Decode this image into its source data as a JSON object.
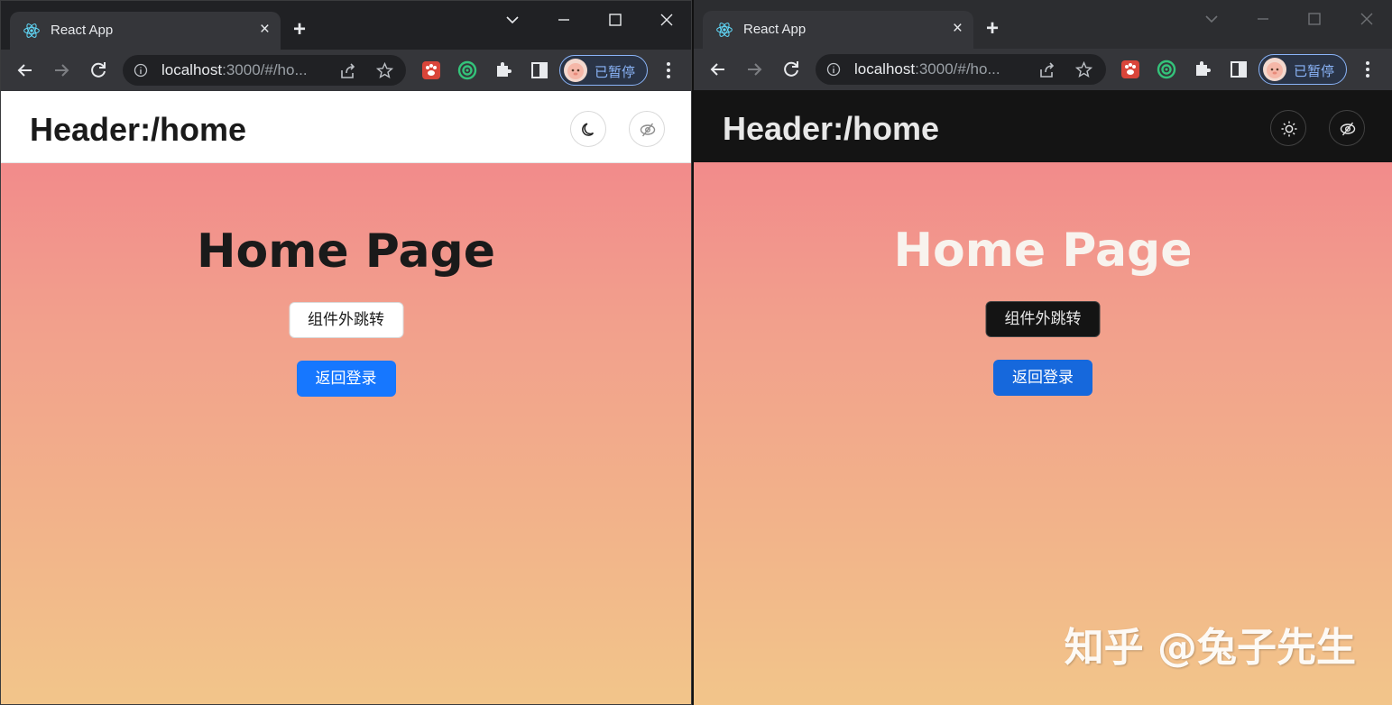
{
  "colors": {
    "chrome_dark": "#202124",
    "chrome_toolbar": "#35363a",
    "primary_blue": "#1677ff",
    "gradient_top": "#f28b8b",
    "gradient_bottom": "#f2c58a",
    "dark_header": "#141414"
  },
  "windows": [
    {
      "theme": "light",
      "tab": {
        "title": "React App",
        "close": "×",
        "favicon": "react-icon"
      },
      "newtab": "+",
      "omnibox": {
        "host": "localhost",
        "rest": ":3000/#/ho..."
      },
      "profile": {
        "label": "已暂停"
      },
      "header": {
        "title": "Header:/home",
        "theme_toggle_icon": "moon-icon",
        "extra_icon": "eye-off-icon"
      },
      "page": {
        "title": "Home Page",
        "button_default": "组件外跳转",
        "button_primary": "返回登录"
      }
    },
    {
      "theme": "dark",
      "tab": {
        "title": "React App",
        "close": "×",
        "favicon": "react-icon"
      },
      "newtab": "+",
      "omnibox": {
        "host": "localhost",
        "rest": ":3000/#/ho..."
      },
      "profile": {
        "label": "已暂停"
      },
      "header": {
        "title": "Header:/home",
        "theme_toggle_icon": "sun-icon",
        "extra_icon": "eye-off-icon"
      },
      "page": {
        "title": "Home Page",
        "button_default": "组件外跳转",
        "button_primary": "返回登录"
      }
    }
  ],
  "watermark": "知乎 @兔子先生"
}
